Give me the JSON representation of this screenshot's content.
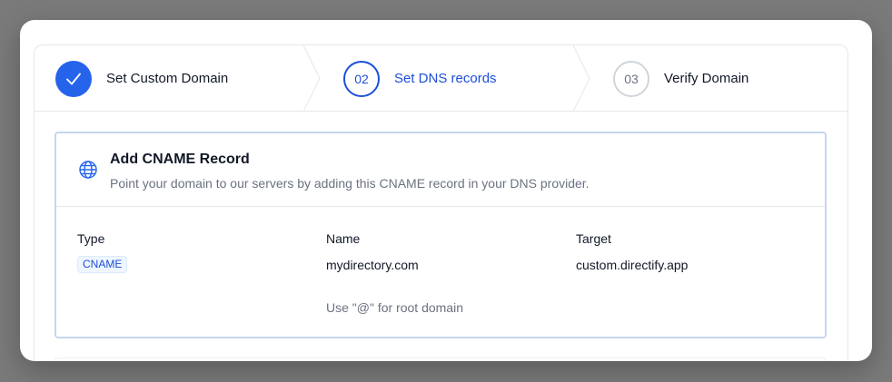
{
  "stepper": {
    "steps": [
      {
        "number": "",
        "label": "Set Custom Domain",
        "state": "done"
      },
      {
        "number": "02",
        "label": "Set DNS records",
        "state": "current"
      },
      {
        "number": "03",
        "label": "Verify Domain",
        "state": "upcoming"
      }
    ]
  },
  "card": {
    "icon": "globe-icon",
    "title": "Add CNAME Record",
    "description": "Point your domain to our servers by adding this CNAME record in your DNS provider.",
    "columns": {
      "type_header": "Type",
      "name_header": "Name",
      "target_header": "Target"
    },
    "record": {
      "type": "CNAME",
      "name": "mydirectory.com",
      "name_hint": "Use \"@\" for root domain",
      "target": "custom.directify.app"
    }
  },
  "colors": {
    "accent": "#1d4ed8",
    "done_circle": "#2563eb",
    "upcoming_border": "#d1d5db",
    "badge_bg": "#eff6ff"
  }
}
